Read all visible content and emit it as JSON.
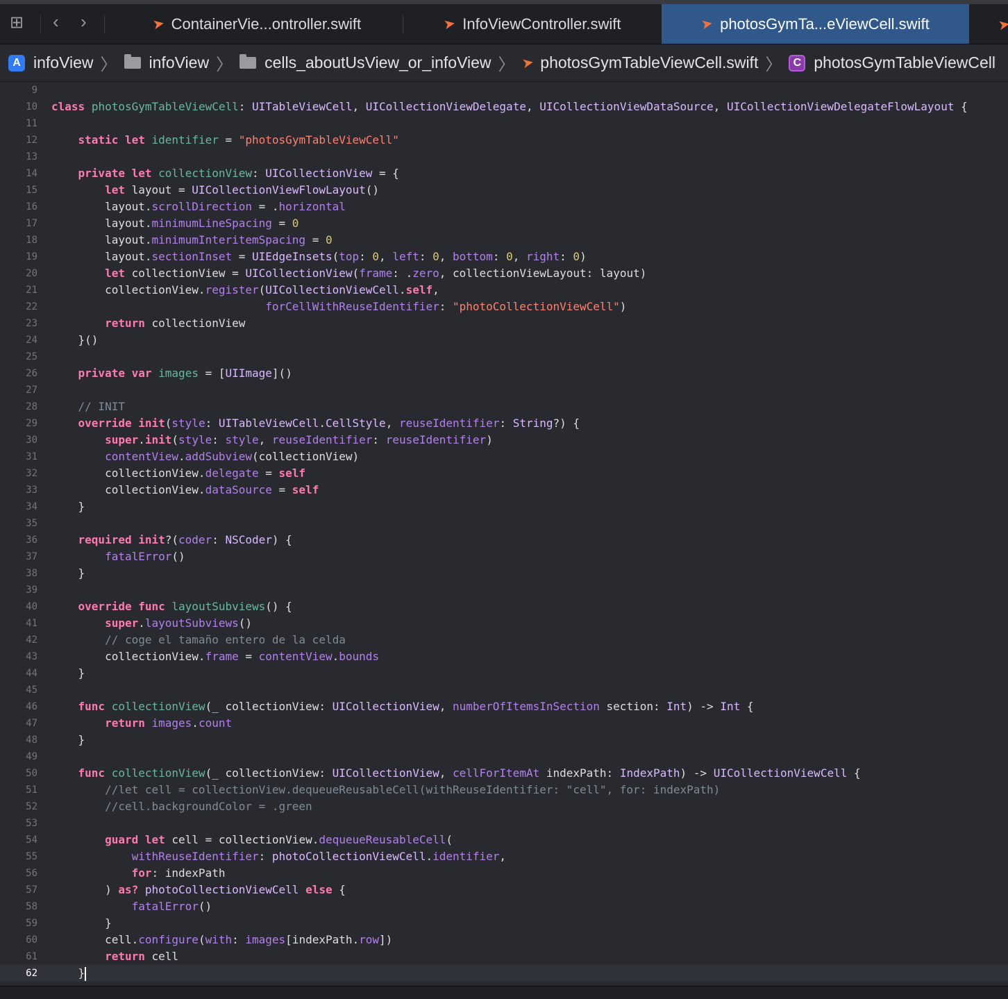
{
  "tabs": [
    {
      "label": "ContainerVie...ontroller.swift",
      "active": false
    },
    {
      "label": "InfoViewController.swift",
      "active": false
    },
    {
      "label": "photosGymTa...eViewCell.swift",
      "active": true
    }
  ],
  "breadcrumb": [
    {
      "label": "infoView",
      "icon": "app-icon"
    },
    {
      "label": "infoView",
      "icon": "folder-icon"
    },
    {
      "label": "cells_aboutUsView_or_infoView",
      "icon": "folder-icon"
    },
    {
      "label": "photosGymTableViewCell.swift",
      "icon": "swift-file-icon"
    },
    {
      "label": "photosGymTableViewCell",
      "icon": "class-icon"
    }
  ],
  "editor": {
    "current_line": 62,
    "lines": [
      {
        "n": "9",
        "code": ""
      },
      {
        "n": "10",
        "code": "class photosGymTableViewCell: UITableViewCell, UICollectionViewDelegate, UICollectionViewDataSource, UICollectionViewDelegateFlowLayout {"
      },
      {
        "n": "11",
        "code": ""
      },
      {
        "n": "12",
        "code": "    static let identifier = \"photosGymTableViewCell\""
      },
      {
        "n": "13",
        "code": ""
      },
      {
        "n": "14",
        "code": "    private let collectionView: UICollectionView = {"
      },
      {
        "n": "15",
        "code": "        let layout = UICollectionViewFlowLayout()"
      },
      {
        "n": "16",
        "code": "        layout.scrollDirection = .horizontal"
      },
      {
        "n": "17",
        "code": "        layout.minimumLineSpacing = 0"
      },
      {
        "n": "18",
        "code": "        layout.minimumInteritemSpacing = 0"
      },
      {
        "n": "19",
        "code": "        layout.sectionInset = UIEdgeInsets(top: 0, left: 0, bottom: 0, right: 0)"
      },
      {
        "n": "20",
        "code": "        let collectionView = UICollectionView(frame: .zero, collectionViewLayout: layout)"
      },
      {
        "n": "21",
        "code": "        collectionView.register(UICollectionViewCell.self,"
      },
      {
        "n": "22",
        "code": "                                forCellWithReuseIdentifier: \"photoCollectionViewCell\")"
      },
      {
        "n": "23",
        "code": "        return collectionView"
      },
      {
        "n": "24",
        "code": "    }()"
      },
      {
        "n": "25",
        "code": ""
      },
      {
        "n": "26",
        "code": "    private var images = [UIImage]()"
      },
      {
        "n": "27",
        "code": ""
      },
      {
        "n": "28",
        "code": "    // INIT"
      },
      {
        "n": "29",
        "code": "    override init(style: UITableViewCell.CellStyle, reuseIdentifier: String?) {"
      },
      {
        "n": "30",
        "code": "        super.init(style: style, reuseIdentifier: reuseIdentifier)"
      },
      {
        "n": "31",
        "code": "        contentView.addSubview(collectionView)"
      },
      {
        "n": "32",
        "code": "        collectionView.delegate = self"
      },
      {
        "n": "33",
        "code": "        collectionView.dataSource = self"
      },
      {
        "n": "34",
        "code": "    }"
      },
      {
        "n": "35",
        "code": ""
      },
      {
        "n": "36",
        "code": "    required init?(coder: NSCoder) {"
      },
      {
        "n": "37",
        "code": "        fatalError()"
      },
      {
        "n": "38",
        "code": "    }"
      },
      {
        "n": "39",
        "code": ""
      },
      {
        "n": "40",
        "code": "    override func layoutSubviews() {"
      },
      {
        "n": "41",
        "code": "        super.layoutSubviews()"
      },
      {
        "n": "42",
        "code": "        // coge el tamaño entero de la celda"
      },
      {
        "n": "43",
        "code": "        collectionView.frame = contentView.bounds"
      },
      {
        "n": "44",
        "code": "    }"
      },
      {
        "n": "45",
        "code": ""
      },
      {
        "n": "46",
        "code": "    func collectionView(_ collectionView: UICollectionView, numberOfItemsInSection section: Int) -> Int {"
      },
      {
        "n": "47",
        "code": "        return images.count"
      },
      {
        "n": "48",
        "code": "    }"
      },
      {
        "n": "49",
        "code": ""
      },
      {
        "n": "50",
        "code": "    func collectionView(_ collectionView: UICollectionView, cellForItemAt indexPath: IndexPath) -> UICollectionViewCell {"
      },
      {
        "n": "51",
        "code": "        //let cell = collectionView.dequeueReusableCell(withReuseIdentifier: \"cell\", for: indexPath)"
      },
      {
        "n": "52",
        "code": "        //cell.backgroundColor = .green"
      },
      {
        "n": "53",
        "code": ""
      },
      {
        "n": "54",
        "code": "        guard let cell = collectionView.dequeueReusableCell("
      },
      {
        "n": "55",
        "code": "            withReuseIdentifier: photoCollectionViewCell.identifier,"
      },
      {
        "n": "56",
        "code": "            for: indexPath"
      },
      {
        "n": "57",
        "code": "        ) as? photoCollectionViewCell else {"
      },
      {
        "n": "58",
        "code": "            fatalError()"
      },
      {
        "n": "59",
        "code": "        }"
      },
      {
        "n": "60",
        "code": "        cell.configure(with: images[indexPath.row])"
      },
      {
        "n": "61",
        "code": "        return cell"
      },
      {
        "n": "62",
        "code": "    }"
      }
    ]
  },
  "colors": {
    "keyword": "#ff7ab2",
    "type": "#dabaff",
    "declaration": "#67b7a4",
    "property": "#b281eb",
    "string": "#ff8170",
    "number": "#d9c97c",
    "comment": "#7f8c98",
    "active_tab": "#30588a",
    "background": "#292a30"
  }
}
